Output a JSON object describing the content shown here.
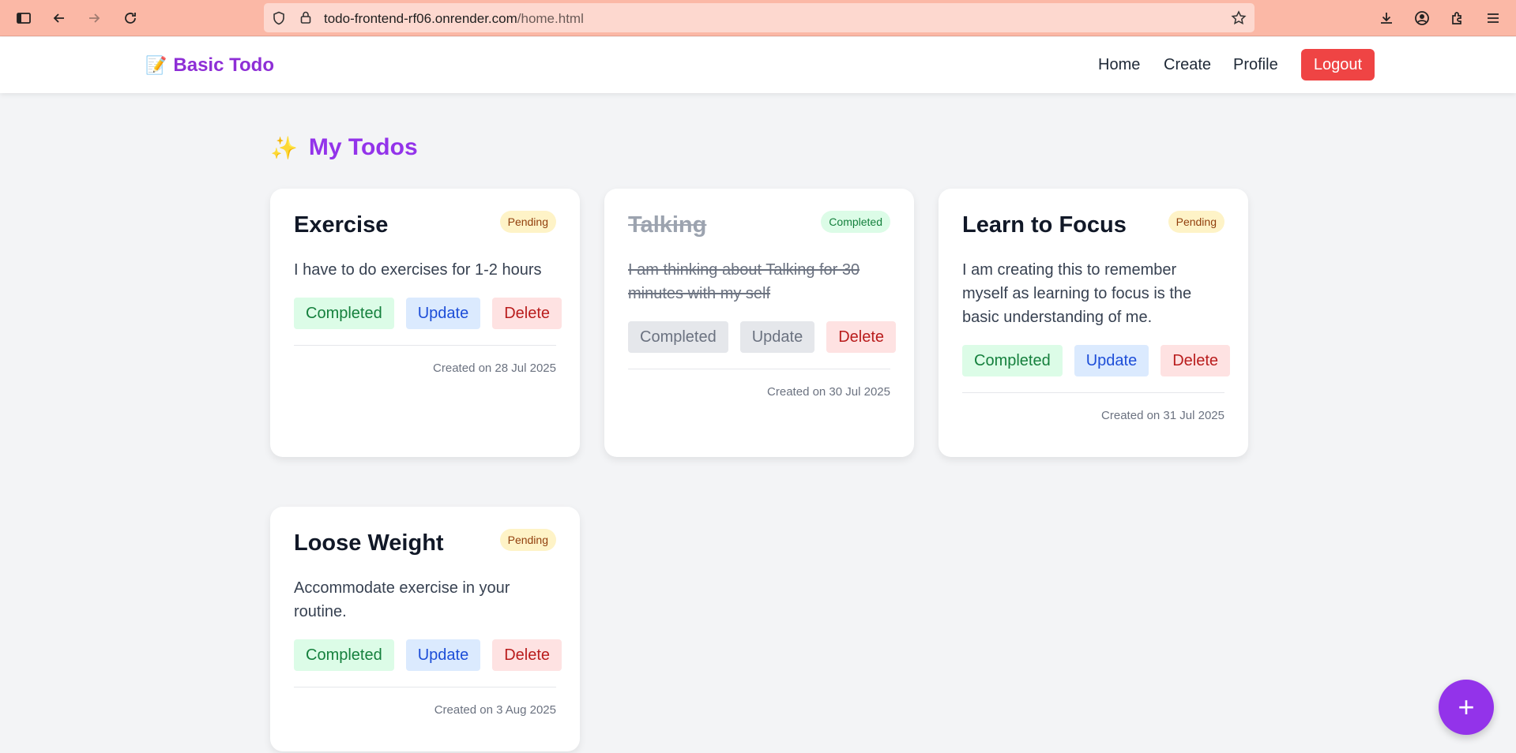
{
  "browser": {
    "url_host": "todo-frontend-rf06.onrender.com",
    "url_path": "/home.html"
  },
  "nav": {
    "brand_icon": "📝",
    "brand": "Basic Todo",
    "links": [
      "Home",
      "Create",
      "Profile"
    ],
    "logout": "Logout"
  },
  "main": {
    "heading_icon": "✨",
    "heading": "My Todos"
  },
  "todos": [
    {
      "title": "Exercise",
      "status": "Pending",
      "description": "I have to do exercises for 1-2 hours",
      "completed_label": "Completed",
      "update_label": "Update",
      "delete_label": "Delete",
      "created": "Created on 28 Jul 2025"
    },
    {
      "title": "Talking",
      "status": "Completed",
      "description": "I am thinking about Talking for 30 minutes with my self",
      "completed_label": "Completed",
      "update_label": "Update",
      "delete_label": "Delete",
      "created": "Created on 30 Jul 2025"
    },
    {
      "title": "Learn to Focus",
      "status": "Pending",
      "description": "I am creating this to remember myself as learning to focus is the basic understanding of me.",
      "completed_label": "Completed",
      "update_label": "Update",
      "delete_label": "Delete",
      "created": "Created on 31 Jul 2025"
    },
    {
      "title": "Loose Weight",
      "status": "Pending",
      "description": "Accommodate exercise in your routine.",
      "completed_label": "Completed",
      "update_label": "Update",
      "delete_label": "Delete",
      "created": "Created on 3 Aug 2025"
    }
  ],
  "fab": "+",
  "colors": {
    "brand": "#9333ea",
    "logout": "#ef4444",
    "pending_badge": "#fef3c7",
    "completed_badge": "#dcfce7"
  }
}
